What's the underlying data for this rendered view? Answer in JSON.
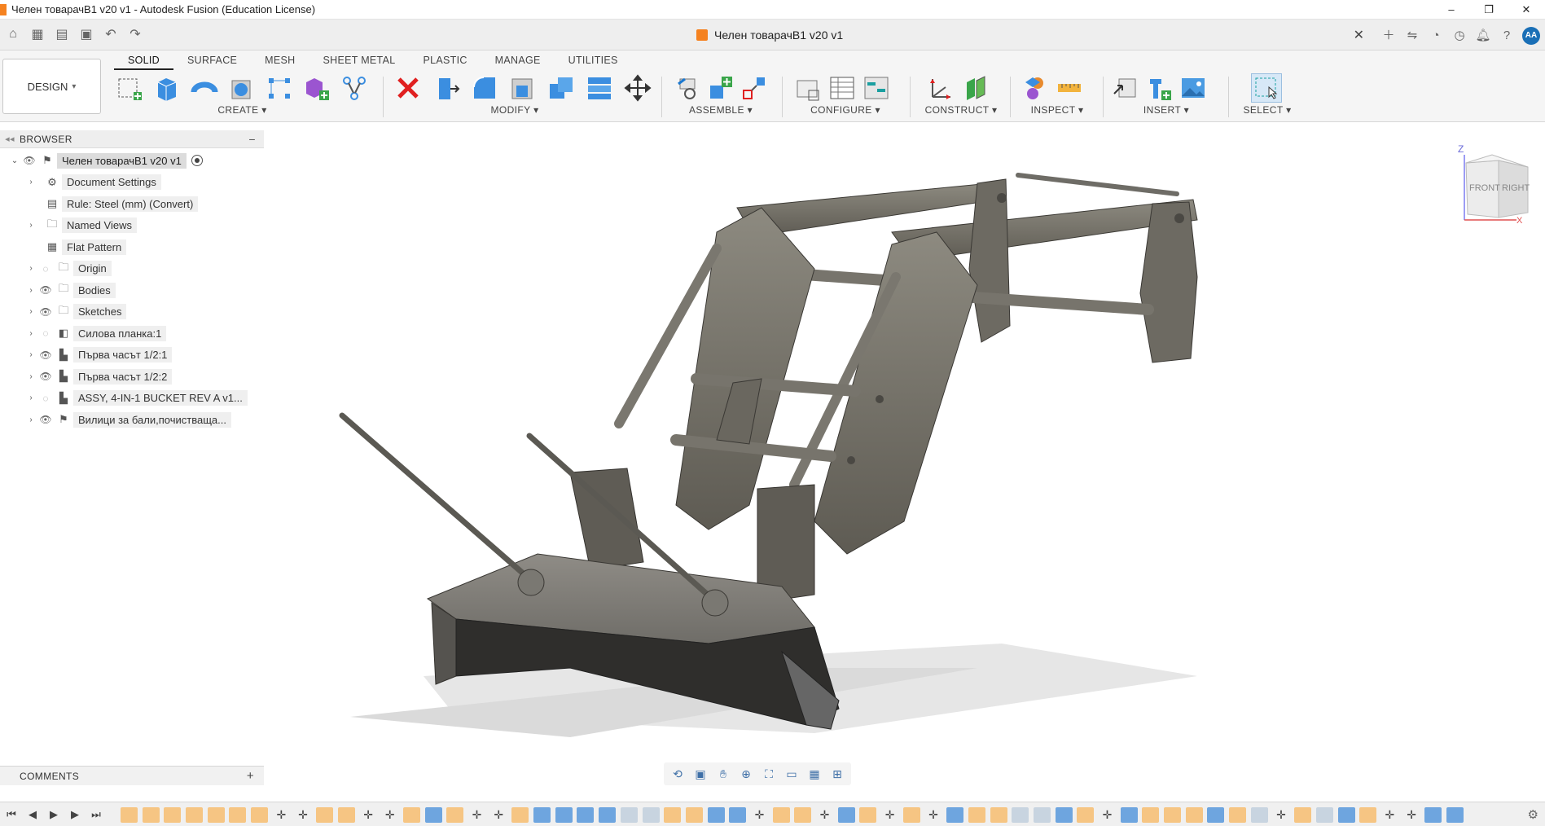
{
  "window": {
    "title": "Челен товарачВ1 v20 v1 - Autodesk Fusion (Education License)",
    "minimize": "–",
    "restore": "❐",
    "close": "✕"
  },
  "document": {
    "tab_title": "Челен товарачВ1 v20 v1",
    "close": "✕"
  },
  "user": {
    "initials": "AA"
  },
  "workspace": {
    "label": "DESIGN",
    "caret": "▾"
  },
  "ribbon": {
    "tabs": [
      "SOLID",
      "SURFACE",
      "MESH",
      "SHEET METAL",
      "PLASTIC",
      "MANAGE",
      "UTILITIES"
    ],
    "active_tab": "SOLID",
    "groups": {
      "create": "CREATE ▾",
      "modify": "MODIFY ▾",
      "assemble": "ASSEMBLE ▾",
      "configure": "CONFIGURE ▾",
      "construct": "CONSTRUCT ▾",
      "inspect": "INSPECT ▾",
      "insert": "INSERT ▾",
      "select": "SELECT ▾"
    }
  },
  "browser": {
    "title": "BROWSER",
    "items": [
      {
        "label": "Челен товарачВ1 v20 v1",
        "icon": "component-icon"
      },
      {
        "label": "Document Settings",
        "icon": "gear-icon"
      },
      {
        "label": "Rule: Steel (mm) (Convert)",
        "icon": "rule-icon"
      },
      {
        "label": "Named Views",
        "icon": "folder-icon"
      },
      {
        "label": "Flat Pattern",
        "icon": "flat-pattern-icon"
      },
      {
        "label": "Origin",
        "icon": "folder-icon"
      },
      {
        "label": "Bodies",
        "icon": "folder-icon"
      },
      {
        "label": "Sketches",
        "icon": "folder-icon"
      },
      {
        "label": "Силова планка:1",
        "icon": "body-icon"
      },
      {
        "label": "Първа часът 1/2:1",
        "icon": "component-icon"
      },
      {
        "label": "Първа часът 1/2:2",
        "icon": "component-icon"
      },
      {
        "label": "ASSY, 4-IN-1 BUCKET REV A v1...",
        "icon": "component-icon"
      },
      {
        "label": "Вилици за бали,почистваща...",
        "icon": "component-icon"
      }
    ]
  },
  "comments": {
    "title": "COMMENTS"
  },
  "viewcube": {
    "front": "FRONT",
    "right": "RIGHT",
    "z": "Z",
    "x": "X"
  }
}
